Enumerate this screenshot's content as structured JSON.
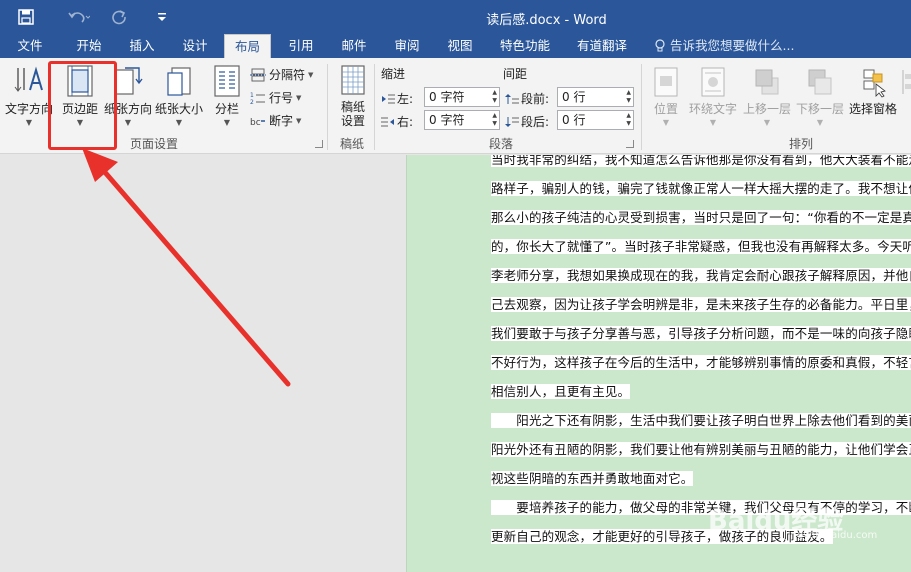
{
  "window": {
    "title": "读后感.docx - Word",
    "qat": [
      "save-icon",
      "undo-icon",
      "redo-icon",
      "customize-icon"
    ]
  },
  "tabs": [
    {
      "label": "文件"
    },
    {
      "label": "开始"
    },
    {
      "label": "插入"
    },
    {
      "label": "设计"
    },
    {
      "label": "布局"
    },
    {
      "label": "引用"
    },
    {
      "label": "邮件"
    },
    {
      "label": "审阅"
    },
    {
      "label": "视图"
    },
    {
      "label": "特色功能"
    },
    {
      "label": "有道翻译"
    }
  ],
  "tellme": "告诉我您想要做什么...",
  "ribbon": {
    "page_setup": {
      "group_label": "页面设置",
      "text_direction": "文字方向",
      "margins": "页边距",
      "orientation": "纸张方向",
      "size": "纸张大小",
      "columns": "分栏",
      "breaks": "分隔符",
      "line_numbers": "行号",
      "hyphenation": "断字"
    },
    "draft": {
      "group_label": "稿纸",
      "settings": "稿纸\n设置",
      "settings_line1": "稿纸",
      "settings_line2": "设置"
    },
    "paragraph": {
      "group_label": "段落",
      "indent": "缩进",
      "spacing": "间距",
      "left_label": "左:",
      "left_value": "0 字符",
      "right_label": "右:",
      "right_value": "0 字符",
      "before_label": "段前:",
      "before_value": "0 行",
      "after_label": "段后:",
      "after_value": "0 行"
    },
    "arrange": {
      "group_label": "排列",
      "position": "位置",
      "wrap_text": "环绕文字",
      "bring_forward": "上移一层",
      "send_backward": "下移一层",
      "selection_pane": "选择窗格"
    }
  },
  "document": {
    "lines": [
      "当时我非常的纠结，我不知道怎么告诉他那是你没有看到，他大大装着不能走",
      "路样子，骗别人的钱，骗完了钱就像正常人一样大摇大摆的走了。我不想让他",
      "那么小的孩子纯洁的心灵受到损害，当时只是回了一句：“你看的不一定是真",
      "的，你长大了就懂了”。当时孩子非常疑惑，但我也没有再解释太多。今天听了",
      "李老师分享，我想如果换成现在的我，我肯定会耐心跟孩子解释原因，并他自",
      "己去观察，因为让孩子学会明辨是非，是未来孩子生存的必备能力。平日里，",
      "我们要敢于与孩子分享善与恶，引导孩子分析问题，而不是一味的向孩子隐瞒",
      "不好行为，这样孩子在今后的生活中，才能够辨别事情的原委和真假，不轻言",
      "相信别人，且更有主见。",
      "　　阳光之下还有阴影，生活中我们要让孩子明白世界上除去他们看到的美丽",
      "阳光外还有丑陋的阴影，我们要让他有辨别美丽与丑陋的能力，让他们学会正",
      "视这些阴暗的东西并勇敢地面对它。",
      "　　要培养孩子的能力，做父母的非常关键，我们父母只有不停的学习，不断",
      "更新自己的观念，才能更好的引导孩子，做孩子的良师益友。"
    ]
  },
  "watermark": {
    "logo": "Baidu经验",
    "url": "jingyan.baidu.com"
  }
}
